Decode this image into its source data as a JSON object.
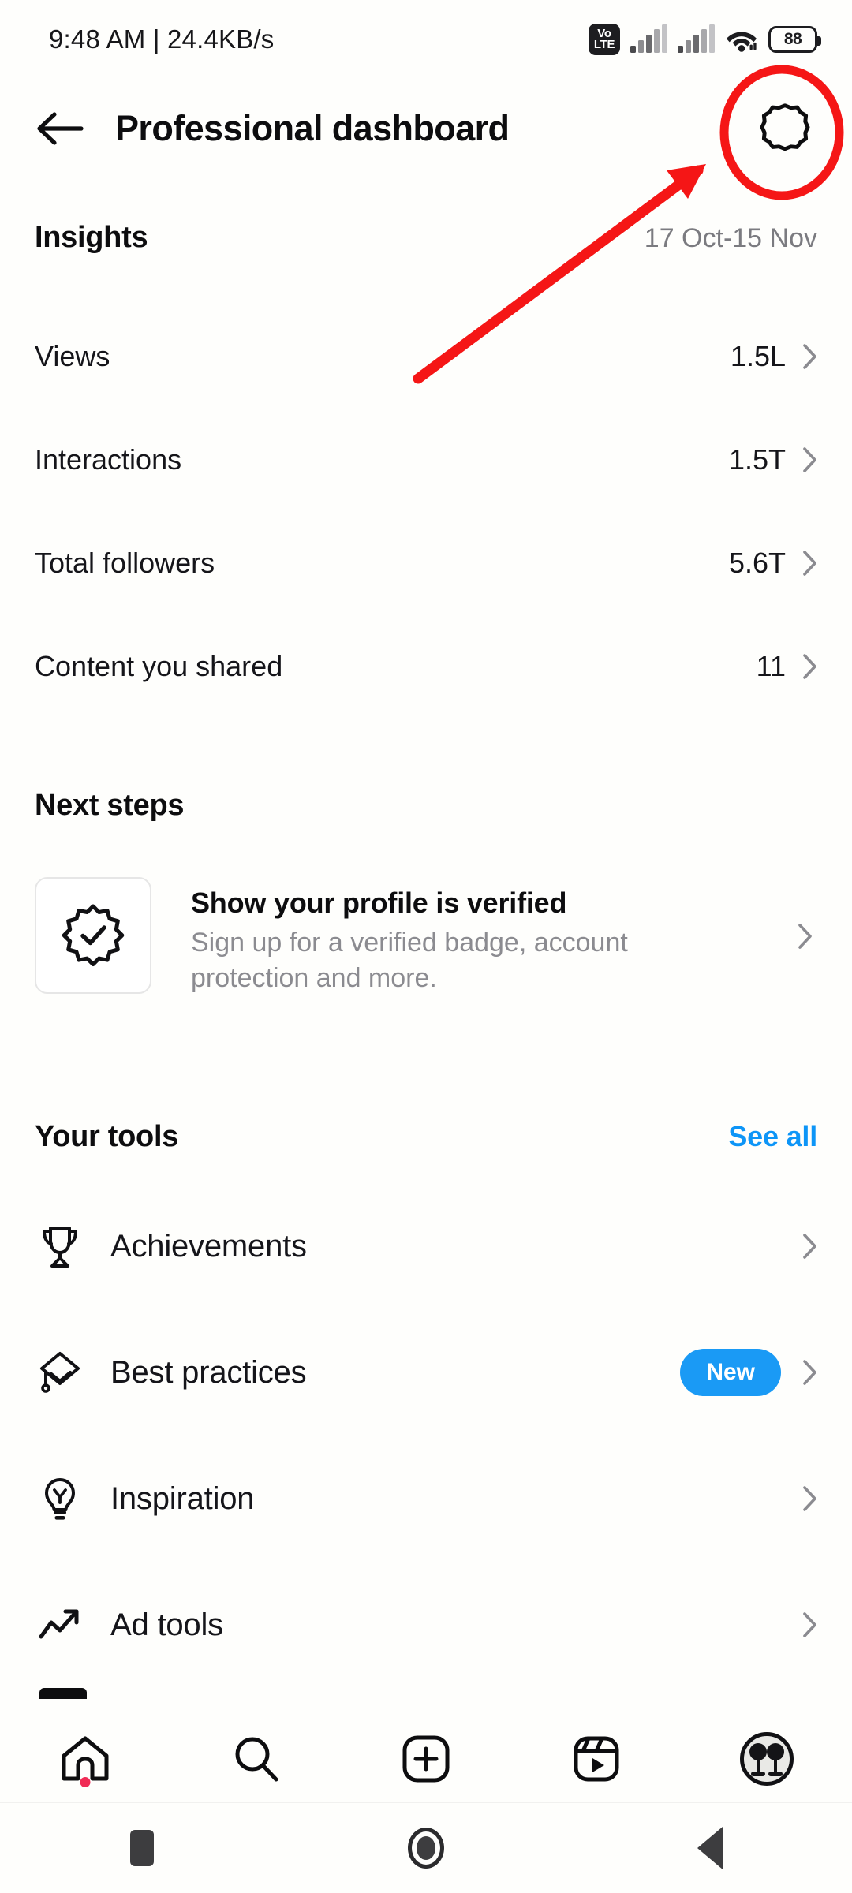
{
  "status_bar": {
    "time_and_speed": "9:48 AM | 24.4KB/s",
    "volte_top": "Vo",
    "volte_bottom": "LTE",
    "battery_level": "88",
    "icons": [
      "volte-icon",
      "signal-bars-icon",
      "signal-bars-icon",
      "wifi-icon",
      "battery-icon"
    ]
  },
  "header": {
    "back_icon": "back-arrow-icon",
    "title": "Professional dashboard",
    "settings_icon": "gear-icon"
  },
  "insights": {
    "title": "Insights",
    "date_range": "17 Oct-15 Nov",
    "rows": [
      {
        "label": "Views",
        "value": "1.5L"
      },
      {
        "label": "Interactions",
        "value": "1.5T"
      },
      {
        "label": "Total followers",
        "value": "5.6T"
      },
      {
        "label": "Content you shared",
        "value": "11"
      }
    ]
  },
  "next_steps": {
    "title": "Next steps",
    "card": {
      "icon": "verified-badge-icon",
      "title": "Show your profile is verified",
      "subtitle": "Sign up for a verified badge, account protection and more."
    }
  },
  "your_tools": {
    "title": "Your tools",
    "see_all": "See all",
    "rows": [
      {
        "label": "Achievements",
        "icon": "trophy-icon",
        "badge": ""
      },
      {
        "label": "Best practices",
        "icon": "graduation-cap-icon",
        "badge": "New"
      },
      {
        "label": "Inspiration",
        "icon": "lightbulb-icon",
        "badge": ""
      },
      {
        "label": "Ad tools",
        "icon": "trending-up-icon",
        "badge": ""
      }
    ]
  },
  "bottom_nav": {
    "items": [
      {
        "name": "home",
        "icon": "home-icon"
      },
      {
        "name": "search",
        "icon": "search-icon"
      },
      {
        "name": "create",
        "icon": "plus-square-icon"
      },
      {
        "name": "reels",
        "icon": "reels-icon"
      },
      {
        "name": "profile",
        "icon": "avatar-icon"
      }
    ]
  },
  "system_nav": {
    "items": [
      {
        "name": "recents",
        "icon": "square-icon"
      },
      {
        "name": "home",
        "icon": "circle-icon"
      },
      {
        "name": "back",
        "icon": "triangle-back-icon"
      }
    ]
  },
  "annotation": {
    "highlight_color": "#f51616",
    "circle_target": "gear-icon",
    "arrow": "arrow-pointing-to-gear"
  }
}
